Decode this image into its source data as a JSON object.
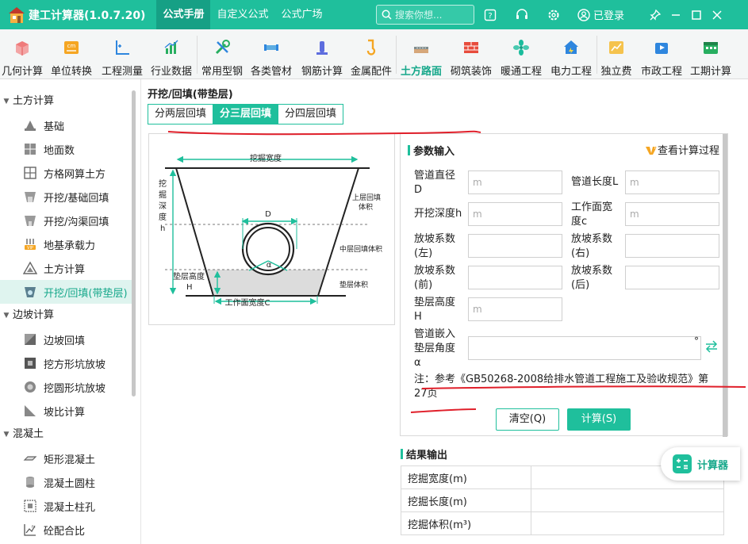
{
  "titlebar": {
    "app_title": "建工计算器(1.0.7.20)",
    "tabs": [
      "公式手册",
      "自定义公式",
      "公式广场"
    ],
    "search_placeholder": "搜索你想...",
    "login_label": "已登录"
  },
  "toolbar": {
    "items": [
      "几何计算",
      "单位转换",
      "工程测量",
      "行业数据",
      "常用型钢",
      "各类管材",
      "钢筋计算",
      "金属配件",
      "土方路面",
      "砌筑装饰",
      "暖通工程",
      "电力工程",
      "独立费",
      "市政工程",
      "工期计算"
    ],
    "active_index": 8
  },
  "sidebar": {
    "group_earthwork": "土方计算",
    "items_earthwork": [
      "基础",
      "地面数",
      "方格网算土方",
      "开挖/基础回填",
      "开挖/沟渠回填",
      "地基承载力",
      "土方计算",
      "开挖/回填(带垫层)"
    ],
    "group_slope": "边坡计算",
    "items_slope": [
      "边坡回填",
      "挖方形坑放坡",
      "挖圆形坑放坡",
      "坡比计算"
    ],
    "group_concrete": "混凝土",
    "items_concrete": [
      "矩形混凝土",
      "混凝土圆柱",
      "混凝土柱孔",
      "砼配合比"
    ]
  },
  "main": {
    "page_title": "开挖/回填(带垫层)",
    "layer_tabs": [
      "分两层回填",
      "分三层回填",
      "分四层回填"
    ],
    "active_tab": 1
  },
  "diagram": {
    "excavation_width": "挖掘宽度",
    "depth_label": [
      "挖",
      "掘",
      "深",
      "度",
      "h"
    ],
    "diameter": "D",
    "angle": "α",
    "upper_fill": [
      "上层回填",
      "体积"
    ],
    "middle_fill": "中层回填体积",
    "cushion_volume": "垫层体积",
    "cushion_height": [
      "垫层高度",
      "H"
    ],
    "working_width": "工作面宽度C"
  },
  "params": {
    "header": "参数输入",
    "view_process": "查看计算过程",
    "pipe_diameter": [
      "管道直径",
      "D"
    ],
    "pipe_length": "管道长度L",
    "depth": "开挖深度h",
    "working_width": [
      "工作面宽",
      "度c"
    ],
    "slope_left": [
      "放坡系数",
      "(左)"
    ],
    "slope_right": [
      "放坡系数",
      "(右)"
    ],
    "slope_front": [
      "放坡系数",
      "(前)"
    ],
    "slope_back": [
      "放坡系数",
      "(后)"
    ],
    "cushion_height": [
      "垫层高度",
      "H"
    ],
    "embed_angle": [
      "管道嵌入",
      "垫层角度",
      "α"
    ],
    "unit_m": "m",
    "unit_deg": "°",
    "note": "注：参考《GB50268-2008给排水管道工程施工及验收规范》第27页",
    "btn_clear": "清空(Q)",
    "btn_calc": "计算(S)"
  },
  "results": {
    "header": "结果输出",
    "rows": [
      "挖掘宽度(m)",
      "挖掘长度(m)",
      "挖掘体积(m³)"
    ]
  },
  "floating": {
    "label": "计算器"
  },
  "colors": {
    "brand": "#1fbf9c",
    "brand_dark": "#16a085",
    "annotation": "#e01f2a"
  }
}
